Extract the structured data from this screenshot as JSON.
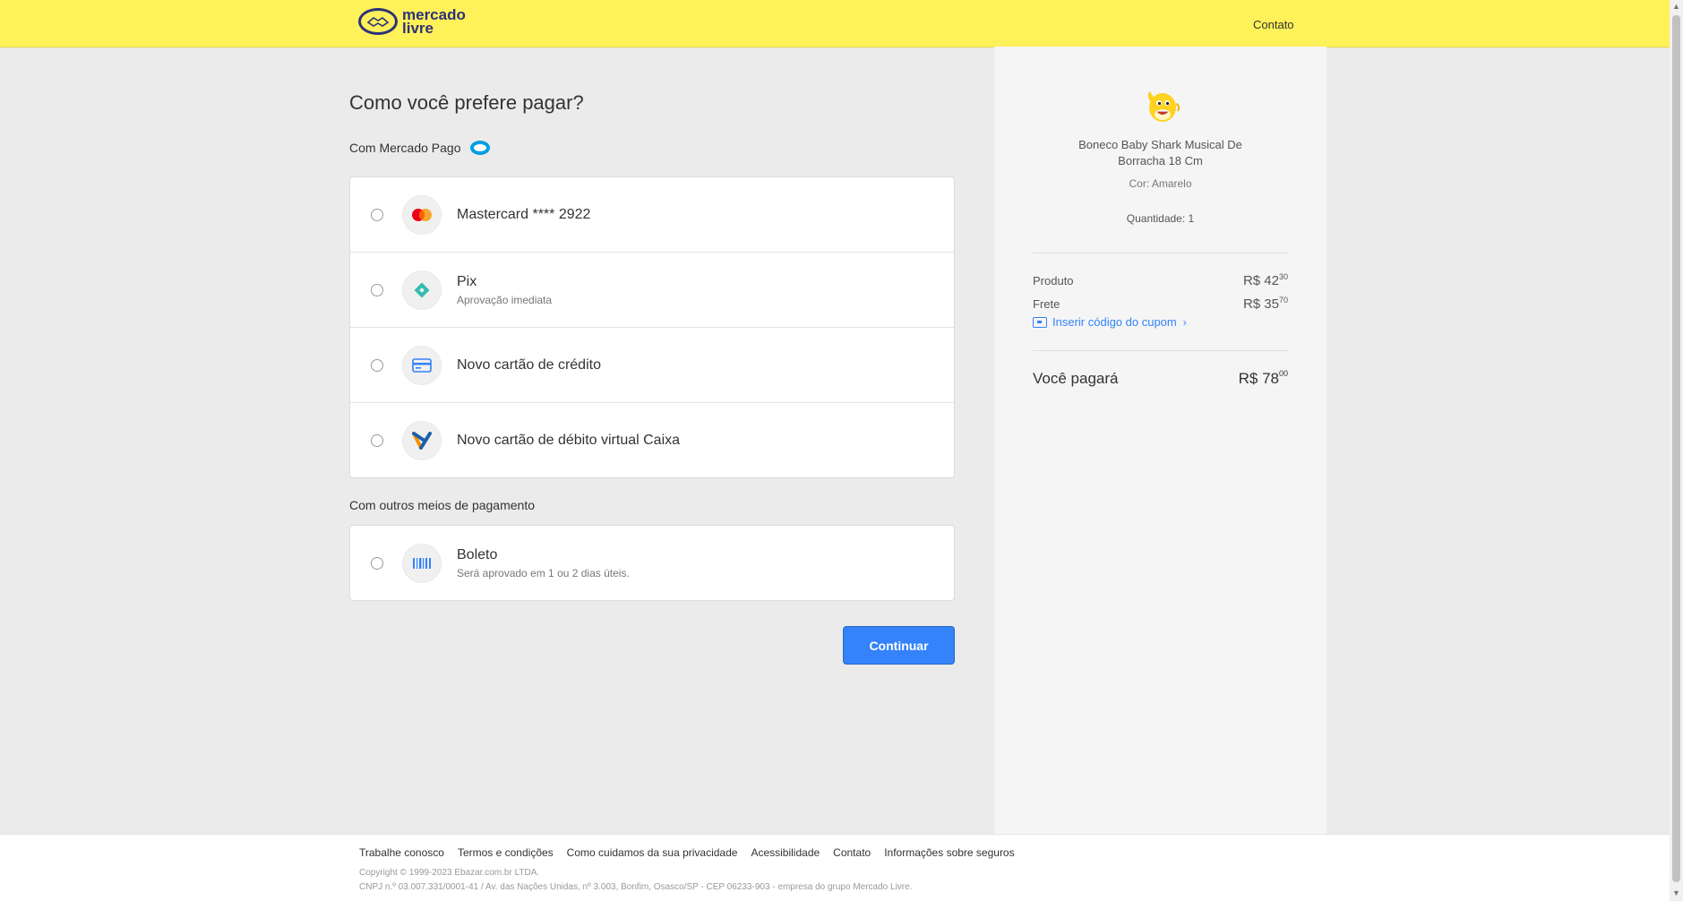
{
  "header": {
    "logo_line1": "mercado",
    "logo_line2": "livre",
    "contact_label": "Contato"
  },
  "main": {
    "title": "Como você prefere pagar?",
    "section_mp_label": "Com Mercado Pago",
    "mp_methods": [
      {
        "title": "Mastercard **** 2922",
        "subtitle": "",
        "icon": "mastercard-icon"
      },
      {
        "title": "Pix",
        "subtitle": "Aprovação imediata",
        "icon": "pix-icon"
      },
      {
        "title": "Novo cartão de crédito",
        "subtitle": "",
        "icon": "credit-card-icon"
      },
      {
        "title": "Novo cartão de débito virtual Caixa",
        "subtitle": "",
        "icon": "caixa-icon"
      }
    ],
    "section_other_label": "Com outros meios de pagamento",
    "other_methods": [
      {
        "title": "Boleto",
        "subtitle": "Será aprovado em 1 ou 2 dias úteis.",
        "icon": "barcode-icon"
      }
    ],
    "continue_label": "Continuar"
  },
  "summary": {
    "product_name": "Boneco Baby Shark Musical De Borracha 18 Cm",
    "product_color": "Cor: Amarelo",
    "quantity": "Quantidade: 1",
    "product_label": "Produto",
    "product_price_main": "R$ 42",
    "product_price_cents": "30",
    "shipping_label": "Frete",
    "shipping_price_main": "R$ 35",
    "shipping_price_cents": "70",
    "coupon_label": "Inserir código do cupom",
    "total_label": "Você pagará",
    "total_price_main": "R$ 78",
    "total_price_cents": "00"
  },
  "footer": {
    "links": [
      "Trabalhe conosco",
      "Termos e condições",
      "Como cuidamos da sua privacidade",
      "Acessibilidade",
      "Contato",
      "Informações sobre seguros"
    ],
    "copyright": "Copyright © 1999-2023 Ebazar.com.br LTDA.",
    "address": "CNPJ n.º 03.007.331/0001-41 / Av. das Nações Unidas, nº 3.003, Bonfim, Osasco/SP - CEP 06233-903 - empresa do grupo Mercado Livre."
  },
  "colors": {
    "header_bg": "#fff159",
    "primary_button": "#3483fa",
    "link": "#3483fa",
    "logo_blue": "#2d3277"
  }
}
